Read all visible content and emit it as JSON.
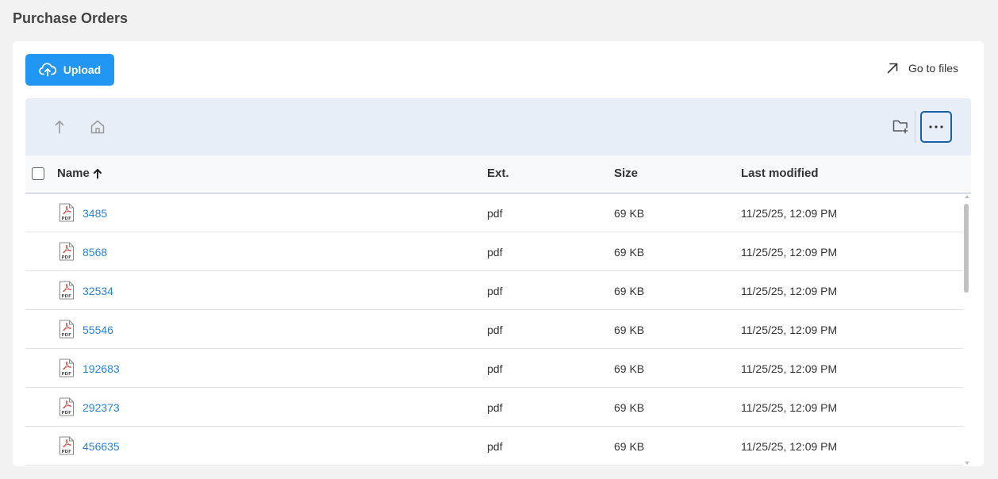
{
  "page": {
    "title": "Purchase Orders"
  },
  "actions": {
    "upload_label": "Upload",
    "goto_label": "Go to files"
  },
  "toolbar": {
    "up_icon": "arrow-up-icon",
    "home_icon": "home-icon",
    "new_folder_icon": "folder-plus-icon",
    "more_icon": "more-horizontal-icon"
  },
  "columns": {
    "name": "Name",
    "ext": "Ext.",
    "size": "Size",
    "modified": "Last modified",
    "sort": "ascending"
  },
  "files": [
    {
      "name": "3485",
      "ext": "pdf",
      "size": "69 KB",
      "modified": "11/25/25, 12:09 PM"
    },
    {
      "name": "8568",
      "ext": "pdf",
      "size": "69 KB",
      "modified": "11/25/25, 12:09 PM"
    },
    {
      "name": "32534",
      "ext": "pdf",
      "size": "69 KB",
      "modified": "11/25/25, 12:09 PM"
    },
    {
      "name": "55546",
      "ext": "pdf",
      "size": "69 KB",
      "modified": "11/25/25, 12:09 PM"
    },
    {
      "name": "192683",
      "ext": "pdf",
      "size": "69 KB",
      "modified": "11/25/25, 12:09 PM"
    },
    {
      "name": "292373",
      "ext": "pdf",
      "size": "69 KB",
      "modified": "11/25/25, 12:09 PM"
    },
    {
      "name": "456635",
      "ext": "pdf",
      "size": "69 KB",
      "modified": "11/25/25, 12:09 PM"
    }
  ],
  "colors": {
    "accent": "#2196f3",
    "link": "#2a82d7",
    "toolbar_bg": "#e8eef7",
    "pdf_red": "#d9534f"
  }
}
